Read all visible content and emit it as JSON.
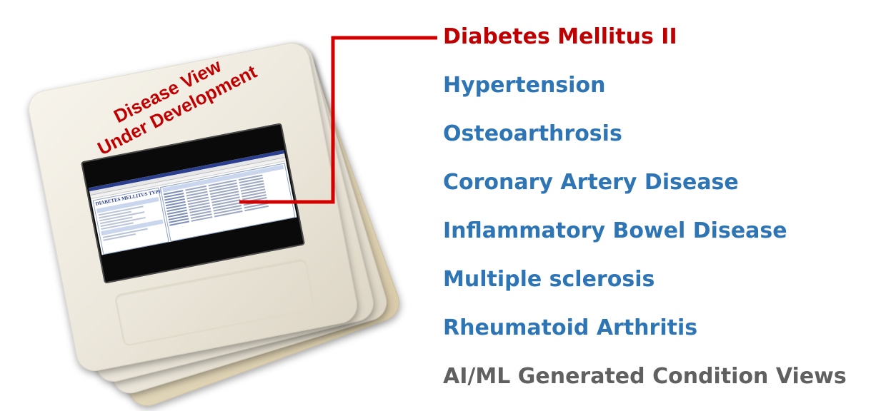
{
  "slide": {
    "label_line1": "Disease View",
    "label_line2": "Under Development",
    "screen_title": "DIABETES MELLITUS TYPE II"
  },
  "conditions": [
    {
      "label": "Diabetes Mellitus II",
      "state": "selected"
    },
    {
      "label": "Hypertension"
    },
    {
      "label": "Osteoarthrosis"
    },
    {
      "label": "Coronary Artery Disease"
    },
    {
      "label": "Inflammatory Bowel Disease"
    },
    {
      "label": "Multiple sclerosis"
    },
    {
      "label": "Rheumatoid Arthritis"
    },
    {
      "label": "AI/ML Generated Condition Views",
      "state": "muted"
    }
  ],
  "colors": {
    "selected": "#c00000",
    "link": "#2e75b6",
    "muted": "#606060",
    "connector": "#d40000"
  }
}
